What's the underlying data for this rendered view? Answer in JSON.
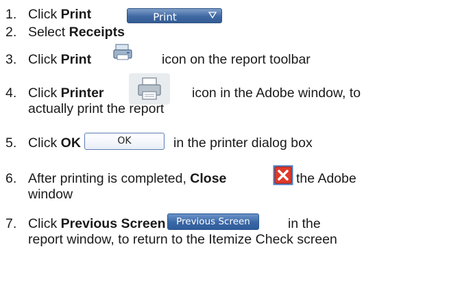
{
  "steps": [
    {
      "num": "1.",
      "pre": "Click ",
      "bold": "Print",
      "button_label": "Print",
      "icon": "chevron-down-icon"
    },
    {
      "num": "2.",
      "pre": "Select ",
      "bold": "Receipts"
    },
    {
      "num": "3.",
      "pre": "Click ",
      "bold": "Print",
      "post": "icon on the report toolbar",
      "icon": "print-toolbar-icon"
    },
    {
      "num": "4.",
      "pre": "Click ",
      "bold": "Printer",
      "post": "icon in the Adobe window, to",
      "line2": "actually print the report",
      "icon": "printer-icon"
    },
    {
      "num": "5.",
      "pre": "Click ",
      "bold": "OK",
      "button_label": "OK",
      "post": "in the printer dialog box"
    },
    {
      "num": "6.",
      "pre": "After printing is completed, ",
      "bold": "Close",
      "post": "the Adobe",
      "line2": "window",
      "icon": "close-icon"
    },
    {
      "num": "7.",
      "pre": "Click ",
      "bold": "Previous Screen",
      "button_label": "Previous Screen",
      "post": "in the",
      "line2": "report window, to return to the Itemize Check screen"
    }
  ],
  "colors": {
    "button_blue": "#3f69a3",
    "close_red": "#e03a2a",
    "text": "#1a1a1a"
  }
}
